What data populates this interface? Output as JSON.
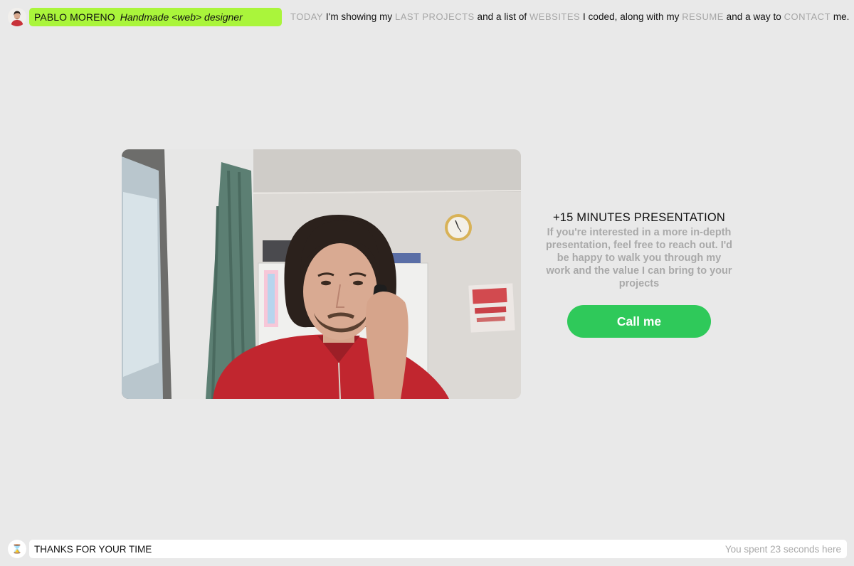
{
  "header": {
    "name": "PABLO MORENO",
    "role": "Handmade <web> designer",
    "intro": {
      "today_link": "TODAY",
      "t1": " I'm showing my ",
      "projects_link": "LAST PROJECTS",
      "t2": " and a list of ",
      "websites_link": "WEBSITES",
      "t3": " I coded, along with my ",
      "resume_link": "RESUME",
      "t4": " and a way to ",
      "contact_link": "CONTACT",
      "t5": " me. ",
      "arrow": "↑"
    }
  },
  "presentation": {
    "title": "+15 MINUTES PRESENTATION",
    "description": "If you're interested in a more in-depth presentation, feel free to reach out. I'd be happy to walk you through my work and the value I can bring to your projects",
    "call_button": "Call me"
  },
  "footer": {
    "hourglass_icon": "⌛",
    "thanks": "THANKS FOR YOUR TIME",
    "timer": "You spent 23 seconds here"
  },
  "colors": {
    "background": "#e9e9e9",
    "name_pill": "#aaf53b",
    "call_button": "#2fc95a",
    "muted_text": "#a9a9a9"
  }
}
